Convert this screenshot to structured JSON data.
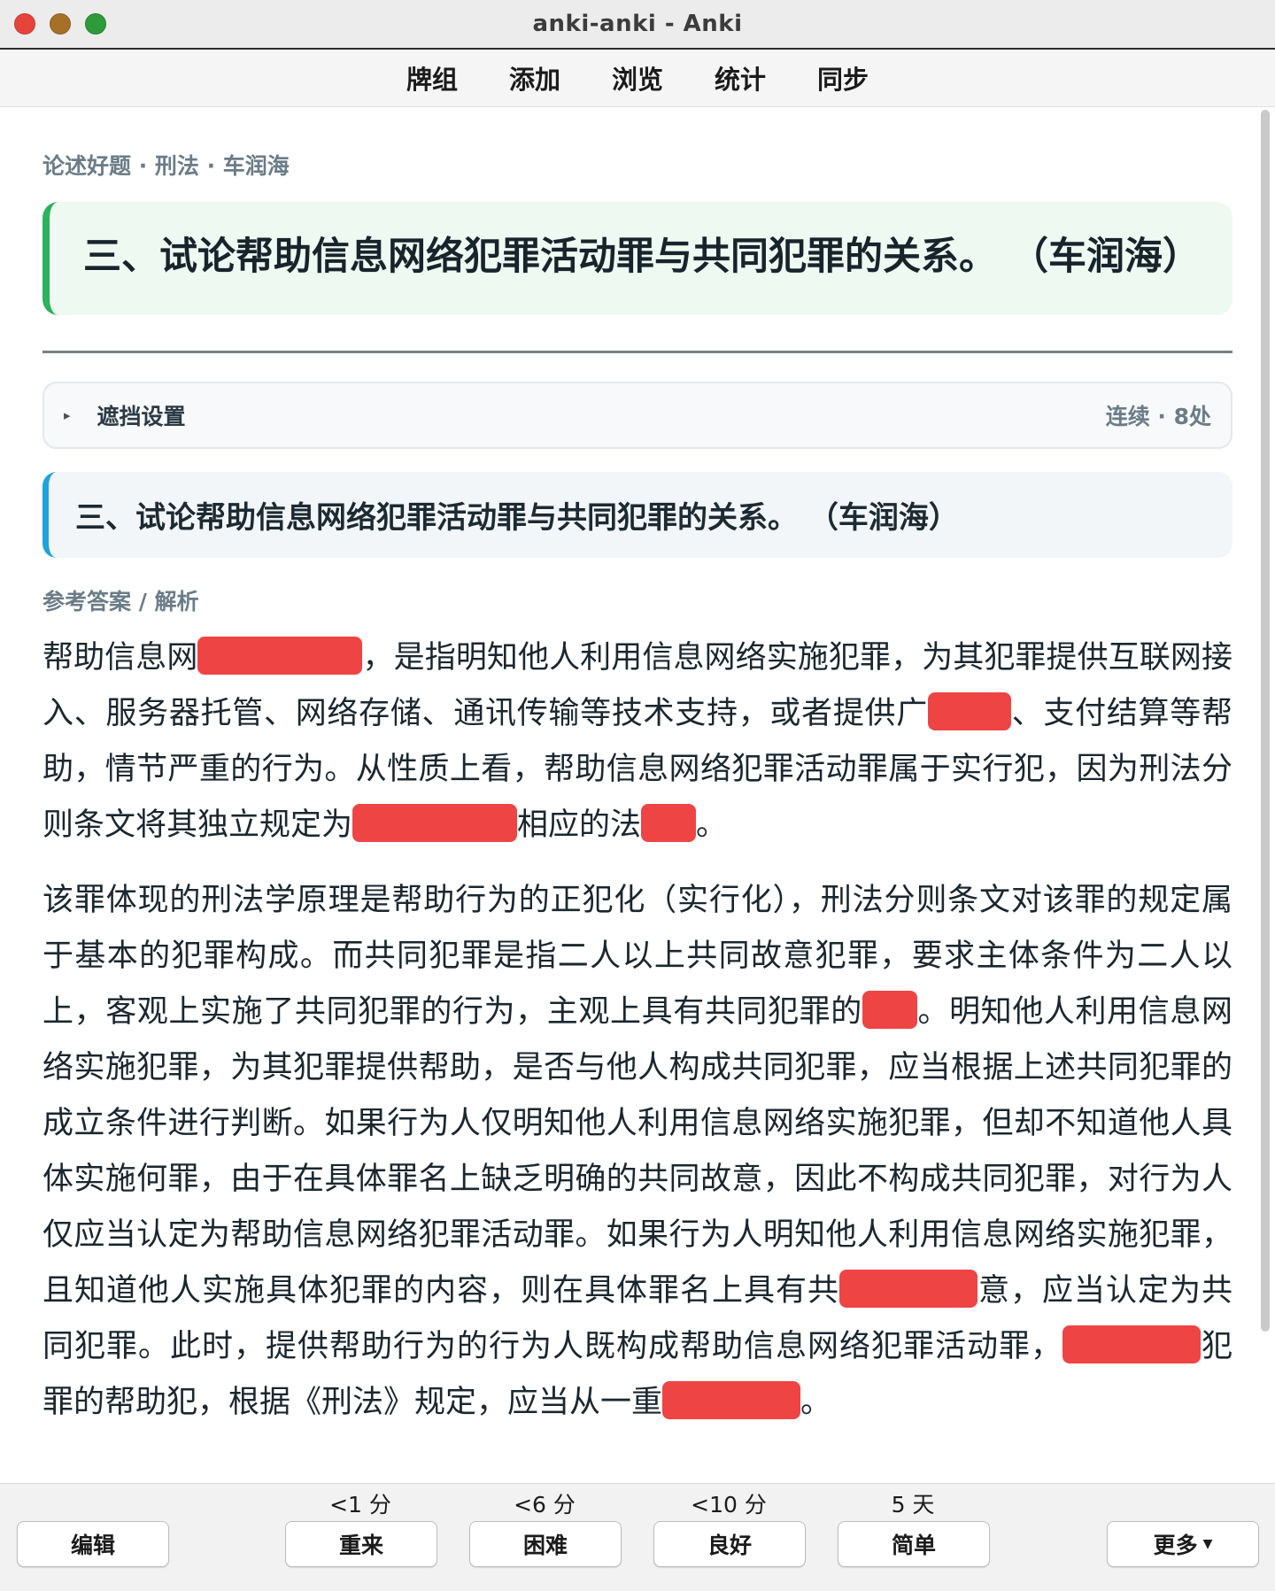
{
  "window": {
    "title": "anki-anki - Anki"
  },
  "menu": {
    "decks": "牌组",
    "add": "添加",
    "browse": "浏览",
    "stats": "统计",
    "sync": "同步"
  },
  "card": {
    "breadcrumb": "论述好题 · 刑法 · 车润海",
    "question": "三、试论帮助信息网络犯罪活动罪与共同犯罪的关系。 （车润海）",
    "mask_settings": {
      "label": "遮挡设置",
      "meta": "连续 · 8处"
    },
    "question_repeat": "三、试论帮助信息网络犯罪活动罪与共同犯罪的关系。 （车润海）",
    "answer_label": "参考答案 / 解析",
    "p1": {
      "a": "帮助信息网",
      "b": "，是指明知他人利用信息网络实施犯罪，为其犯罪提供互联网接入、服务器托管、网络存储、通讯传输等技术支持，或者提供广",
      "c": "、支付结算等帮助，情节严重的行为。从性质上看，帮助信息网络犯罪活动罪属于实行犯，因为刑法分则条文将其独立规定为",
      "d": "相应的法",
      "e": "。"
    },
    "p2": {
      "a": "该罪体现的刑法学原理是帮助行为的正犯化（实行化），刑法分则条文对该罪的规定属于基本的犯罪构成。而共同犯罪是指二人以上共同故意犯罪，要求主体条件为二人以上，客观上实施了共同犯罪的行为，主观上具有共同犯罪的",
      "b": "。明知他人利用信息网络实施犯罪，为其犯罪提供帮助，是否与他人构成共同犯罪，应当根据上述共同犯罪的成立条件进行判断。如果行为人仅明知他人利用信息网络实施犯罪，但却不知道他人具体实施何罪，由于在具体罪名上缺乏明确的共同故意，因此不构成共同犯罪，对行为人仅应当认定为帮助信息网络犯罪活动罪。如果行为人明知他人利用信息网络实施犯罪，且知道他人实施具体犯罪的内容，则在具体罪名上具有共",
      "c": "意，应当认定为共同犯罪。此时，提供帮助行为的行为人既构成帮助信息网络犯罪活动罪，",
      "d": "犯罪的帮助犯，根据《刑法》规定，应当从一重",
      "e": "。"
    }
  },
  "answer_bar": {
    "edit": "编辑",
    "again": "重来",
    "again_interval": "<1 分",
    "hard": "困难",
    "hard_interval": "<6 分",
    "good": "良好",
    "good_interval": "<10 分",
    "easy": "简单",
    "easy_interval": "5 天",
    "more": "更多"
  },
  "colors": {
    "cloze": "#ef4444",
    "question_accent": "#2bb25a",
    "repeat_accent": "#1fa3dc"
  },
  "icons": [
    "close-icon",
    "minimize-icon",
    "zoom-icon",
    "disclosure-triangle-icon",
    "chevron-down-icon"
  ]
}
